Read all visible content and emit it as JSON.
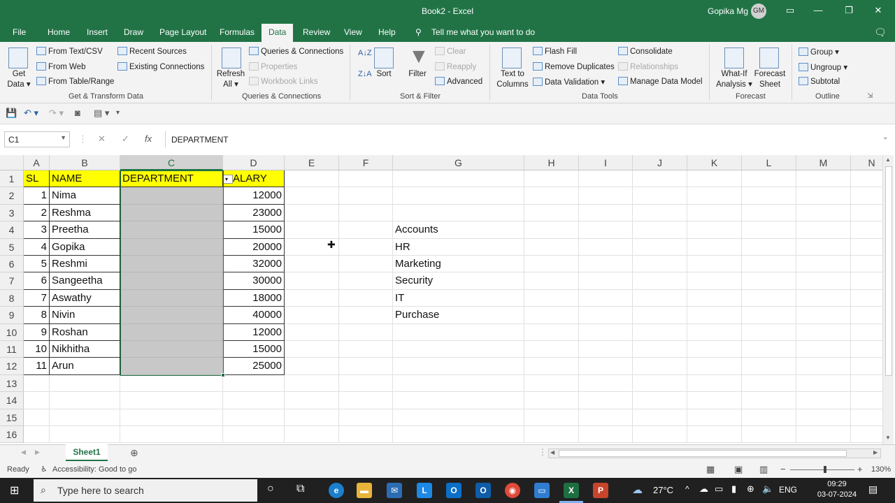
{
  "window": {
    "title": "Book2  -  Excel",
    "user": "Gopika Mg",
    "avatar_initials": "GM"
  },
  "tabs": [
    "File",
    "Home",
    "Insert",
    "Draw",
    "Page Layout",
    "Formulas",
    "Data",
    "Review",
    "View",
    "Help"
  ],
  "active_tab": "Data",
  "tell_me": "Tell me what you want to do",
  "ribbon": {
    "get_transform": {
      "get_data_line1": "Get",
      "get_data_line2": "Data",
      "from_text_csv": "From Text/CSV",
      "from_web": "From Web",
      "from_table_range": "From Table/Range",
      "recent_sources": "Recent Sources",
      "existing_connections": "Existing Connections",
      "group_label": "Get & Transform Data"
    },
    "queries": {
      "refresh_line1": "Refresh",
      "refresh_line2": "All",
      "queries_connections": "Queries & Connections",
      "properties": "Properties",
      "workbook_links": "Workbook Links",
      "group_label": "Queries & Connections"
    },
    "sort_filter": {
      "sort": "Sort",
      "filter": "Filter",
      "clear": "Clear",
      "reapply": "Reapply",
      "advanced": "Advanced",
      "group_label": "Sort & Filter"
    },
    "data_tools": {
      "text_to_columns_line1": "Text to",
      "text_to_columns_line2": "Columns",
      "flash_fill": "Flash Fill",
      "remove_duplicates": "Remove Duplicates",
      "data_validation": "Data Validation",
      "consolidate": "Consolidate",
      "relationships": "Relationships",
      "manage_data_model": "Manage Data Model",
      "group_label": "Data Tools"
    },
    "forecast": {
      "what_if_line1": "What-If",
      "what_if_line2": "Analysis",
      "forecast_sheet_line1": "Forecast",
      "forecast_sheet_line2": "Sheet",
      "group_label": "Forecast"
    },
    "outline": {
      "group": "Group",
      "ungroup": "Ungroup",
      "subtotal": "Subtotal",
      "group_label": "Outline"
    }
  },
  "formula_bar": {
    "name_box": "C1",
    "content": "DEPARTMENT"
  },
  "columns": [
    "A",
    "B",
    "C",
    "D",
    "E",
    "F",
    "G",
    "H",
    "I",
    "J",
    "K",
    "L",
    "M",
    "N"
  ],
  "rows": [
    "1",
    "2",
    "3",
    "4",
    "5",
    "6",
    "7",
    "8",
    "9",
    "10",
    "11",
    "12",
    "13",
    "14",
    "15",
    "16"
  ],
  "table": {
    "headers": [
      "SL",
      "NAME",
      "DEPARTMENT",
      "ALARY"
    ],
    "data": [
      [
        "1",
        "Nima",
        "",
        "12000"
      ],
      [
        "2",
        "Reshma",
        "",
        "23000"
      ],
      [
        "3",
        "Preetha",
        "",
        "15000"
      ],
      [
        "4",
        "Gopika",
        "",
        "20000"
      ],
      [
        "5",
        "Reshmi",
        "",
        "32000"
      ],
      [
        "6",
        "Sangeetha",
        "",
        "30000"
      ],
      [
        "7",
        "Aswathy",
        "",
        "18000"
      ],
      [
        "8",
        "Nivin",
        "",
        "40000"
      ],
      [
        "9",
        "Roshan",
        "",
        "12000"
      ],
      [
        "10",
        "Nikhitha",
        "",
        "15000"
      ],
      [
        "11",
        "Arun",
        "",
        "25000"
      ]
    ]
  },
  "department_list": [
    "Accounts",
    "HR",
    "Marketing",
    "Security",
    "IT",
    "Purchase"
  ],
  "sheet_tab": "Sheet1",
  "status": {
    "ready": "Ready",
    "accessibility": "Accessibility: Good to go",
    "zoom": "130%"
  },
  "taskbar": {
    "search_placeholder": "Type here to search",
    "weather": "27°C",
    "language": "ENG",
    "time": "09:29",
    "date": "03-07-2024"
  },
  "colors": {
    "excel_green": "#217346",
    "header_yellow": "#ffff00",
    "selection_gray": "#c8c8c8"
  }
}
